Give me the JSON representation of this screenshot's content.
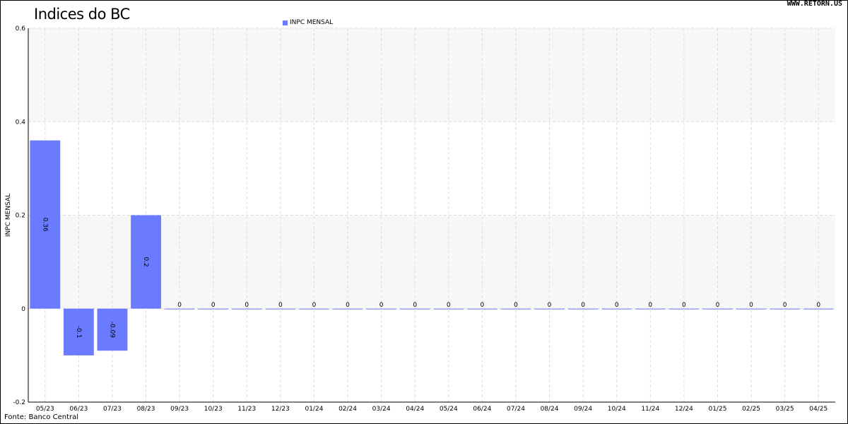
{
  "header": {
    "title": "Indices do BC",
    "watermark": "WWW.RETORN.US"
  },
  "footer": {
    "source": "Fonte: Banco Central"
  },
  "colors": {
    "bar": "#6b7bff",
    "band": "#f7f7f7",
    "grid": "#dddddd"
  },
  "chart_data": {
    "type": "bar",
    "title": "Indices do BC",
    "xlabel": "",
    "ylabel": "INPC MENSAL",
    "ylim": [
      -0.2,
      0.6
    ],
    "yticks": [
      "-0.2",
      "0",
      "0.2",
      "0.4",
      "0.6"
    ],
    "legend": "top-center",
    "grid": true,
    "categories": [
      "05/23",
      "06/23",
      "07/23",
      "08/23",
      "09/23",
      "10/23",
      "11/23",
      "12/23",
      "01/24",
      "02/24",
      "03/24",
      "04/24",
      "05/24",
      "06/24",
      "07/24",
      "08/24",
      "09/24",
      "10/24",
      "11/24",
      "12/24",
      "01/25",
      "02/25",
      "03/25",
      "04/25"
    ],
    "series": [
      {
        "name": "INPC MENSAL",
        "values": [
          0.36,
          -0.1,
          -0.09,
          0.2,
          0,
          0,
          0,
          0,
          0,
          0,
          0,
          0,
          0,
          0,
          0,
          0,
          0,
          0,
          0,
          0,
          0,
          0,
          0,
          0
        ],
        "labels": [
          "0.36",
          "-0.1",
          "-0.09",
          "0.2",
          "0",
          "0",
          "0",
          "0",
          "0",
          "0",
          "0",
          "0",
          "0",
          "0",
          "0",
          "0",
          "0",
          "0",
          "0",
          "0",
          "0",
          "0",
          "0",
          "0"
        ]
      }
    ]
  }
}
